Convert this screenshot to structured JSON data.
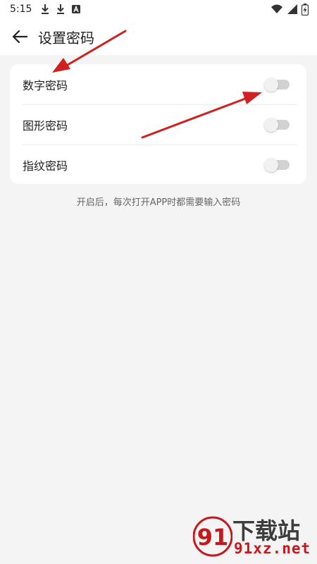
{
  "status_bar": {
    "time": "5:15",
    "left_icons": [
      "download-icon",
      "download-icon",
      "text-a-icon"
    ],
    "right_icons": [
      "wifi-icon",
      "signal-icon",
      "battery-charging-icon"
    ]
  },
  "header": {
    "title": "设置密码",
    "back_icon": "arrow-left-icon"
  },
  "settings": {
    "items": [
      {
        "label": "数字密码",
        "enabled": false
      },
      {
        "label": "图形密码",
        "enabled": false
      },
      {
        "label": "指纹密码",
        "enabled": false
      }
    ]
  },
  "hint": "开启后，每次打开APP时都需要输入密码",
  "annotation": {
    "color": "#d0201f"
  },
  "watermark": {
    "line1": "下载站",
    "line2": "91xz.net",
    "logo_lettering": "91",
    "color": "#c8161d"
  },
  "theme": {
    "background": "#f4f4f4",
    "card": "#ffffff",
    "toggle_off_track": "#d2d2d2"
  }
}
